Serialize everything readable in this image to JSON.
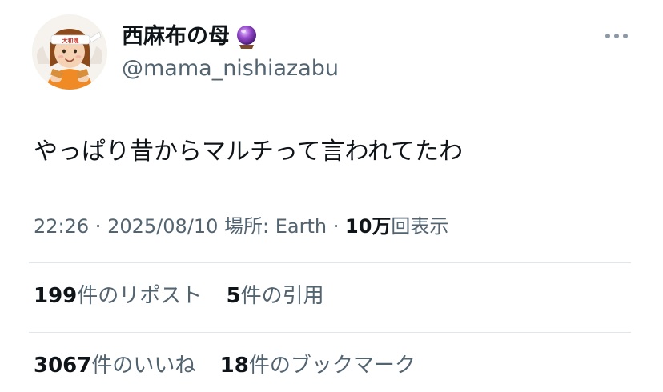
{
  "author": {
    "display_name": "西麻布の母",
    "badge_icon": "crystal-ball-icon",
    "handle": "@mama_nishiazabu",
    "headband_text": "大和魂"
  },
  "post": {
    "text": "やっぱり昔からマルチって言われてたわ"
  },
  "meta": {
    "time": "22:26",
    "separator": " · ",
    "date": "2025/08/10",
    "location_label": "場所: ",
    "location": "Earth",
    "views_count": "10万",
    "views_label": "回表示"
  },
  "stats": {
    "reposts_count": "199",
    "reposts_label": "件のリポスト",
    "quotes_count": "5",
    "quotes_label": "件の引用",
    "likes_count": "3067",
    "likes_label": "件のいいね",
    "bookmarks_count": "18",
    "bookmarks_label": "件のブックマーク"
  },
  "colors": {
    "text_primary": "#0f1419",
    "text_secondary": "#536471",
    "divider": "#e1e6ea",
    "crystal_ball": "#8e44ad"
  }
}
